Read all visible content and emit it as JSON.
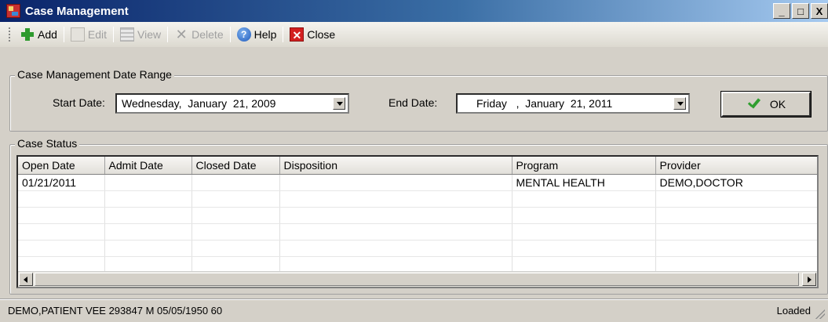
{
  "window": {
    "title": "Case Management",
    "buttons": {
      "minimize": "_",
      "maximize": "□",
      "close": "X"
    }
  },
  "toolbar": {
    "add": "Add",
    "edit": "Edit",
    "view": "View",
    "delete": "Delete",
    "help": "Help",
    "close": "Close"
  },
  "date_range": {
    "group_label": "Case Management Date Range",
    "start_label": "Start Date:",
    "start_value": "Wednesday,  January  21, 2009",
    "end_label": "End Date:",
    "end_value": "Friday   ,  January  21, 2011",
    "ok_label": "OK"
  },
  "case_status": {
    "group_label": "Case Status",
    "columns": [
      "Open Date",
      "Admit Date",
      "Closed Date",
      "Disposition",
      "Program",
      "Provider"
    ],
    "rows": [
      [
        "01/21/2011",
        "",
        "",
        "",
        "MENTAL HEALTH",
        "DEMO,DOCTOR"
      ],
      [
        "",
        "",
        "",
        "",
        "",
        ""
      ],
      [
        "",
        "",
        "",
        "",
        "",
        ""
      ],
      [
        "",
        "",
        "",
        "",
        "",
        ""
      ],
      [
        "",
        "",
        "",
        "",
        "",
        ""
      ],
      [
        "",
        "",
        "",
        "",
        "",
        ""
      ]
    ]
  },
  "statusbar": {
    "patient": "DEMO,PATIENT VEE  293847   M  05/05/1950  60",
    "state": "Loaded"
  },
  "icons": {
    "app": "case-management-app-icon",
    "add": "plus-icon",
    "edit": "edit-icon",
    "view": "view-grid-icon",
    "delete": "x-icon",
    "help": "help-icon",
    "close": "close-icon",
    "ok": "checkmark-icon"
  }
}
